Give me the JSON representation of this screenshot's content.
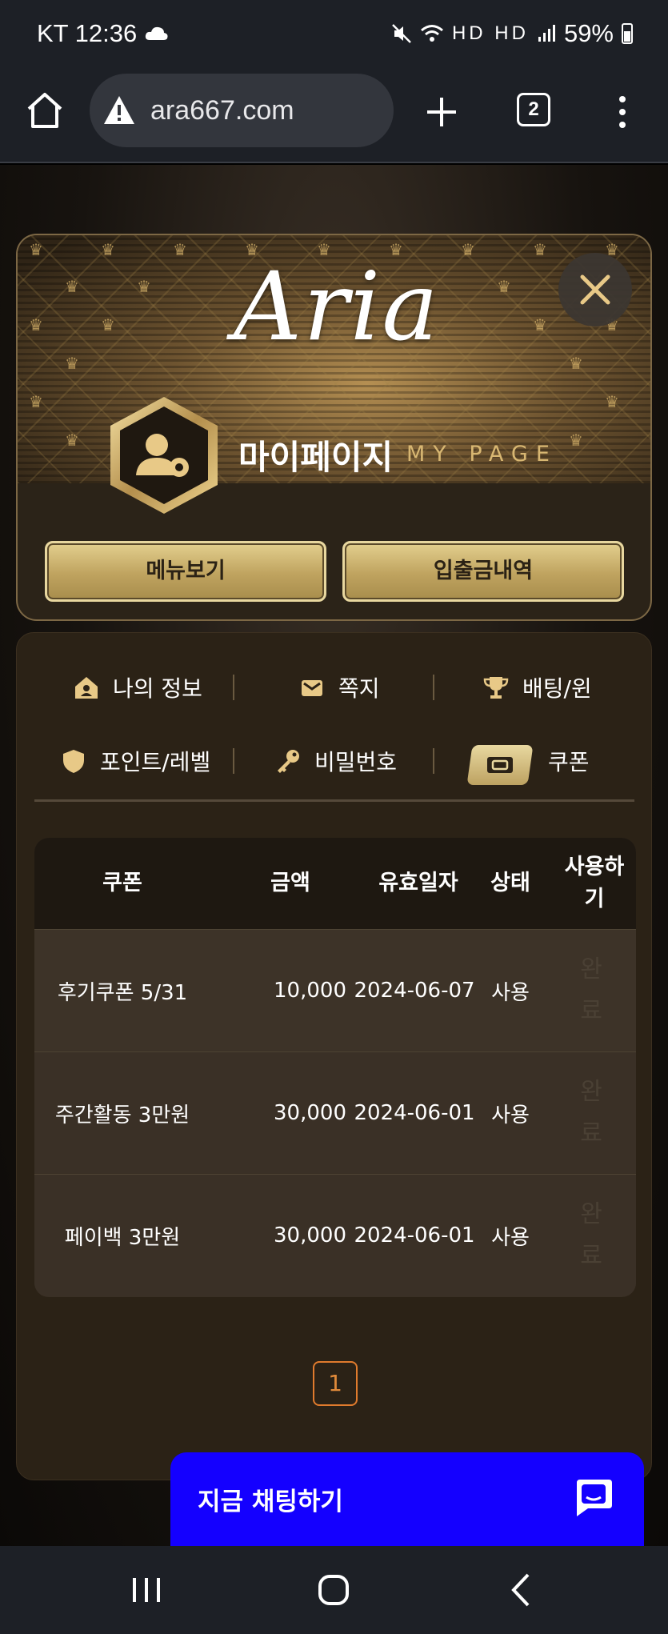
{
  "status_bar": {
    "carrier_time": "KT 12:36",
    "battery": "59%",
    "network": "HD HD"
  },
  "browser": {
    "url": "ara667.com",
    "tab_count": "2"
  },
  "header": {
    "logo": "Aria",
    "title": "마이페이지",
    "subtitle": "MY PAGE",
    "buttons": [
      "메뉴보기",
      "입출금내역"
    ]
  },
  "nav": {
    "items": [
      {
        "label": "나의 정보",
        "icon": "home-icon"
      },
      {
        "label": "쪽지",
        "icon": "envelope-icon"
      },
      {
        "label": "배팅/윈",
        "icon": "trophy-icon"
      },
      {
        "label": "포인트/레벨",
        "icon": "shield-icon"
      },
      {
        "label": "비밀번호",
        "icon": "key-icon"
      },
      {
        "label": "쿠폰",
        "icon": "ticket-icon"
      }
    ],
    "active": "쿠폰"
  },
  "table": {
    "headers": [
      "쿠폰",
      "금액",
      "유효일자",
      "상태",
      "사용하기"
    ],
    "rows": [
      {
        "name": "후기쿠폰 5/31",
        "amount": "10,000",
        "date": "2024-06-07",
        "status": "사용",
        "action_1": "완",
        "action_2": "료"
      },
      {
        "name": "주간활동 3만원",
        "amount": "30,000",
        "date": "2024-06-01",
        "status": "사용",
        "action_1": "완",
        "action_2": "료"
      },
      {
        "name": "페이백 3만원",
        "amount": "30,000",
        "date": "2024-06-01",
        "status": "사용",
        "action_1": "완",
        "action_2": "료"
      }
    ]
  },
  "pagination": {
    "current": "1"
  },
  "chat": {
    "label": "지금 채팅하기"
  },
  "colors": {
    "gold": "#d8b772",
    "chat_blue": "#1400ff",
    "page_orange": "#e07b2d"
  }
}
